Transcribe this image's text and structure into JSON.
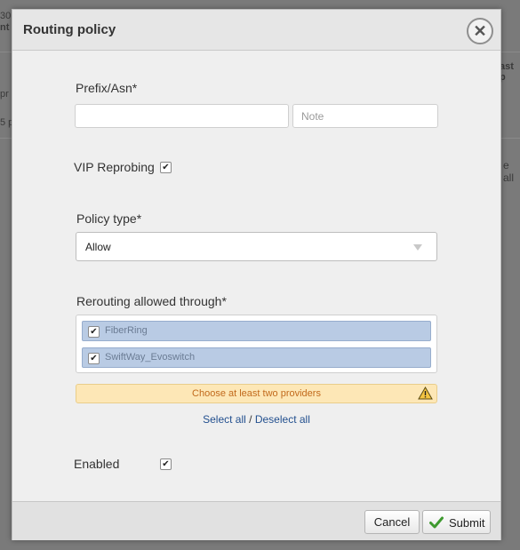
{
  "background": {
    "fragments": [
      "30",
      "nt",
      "pr",
      "5 p",
      "ast p",
      "e all"
    ]
  },
  "dialog": {
    "title": "Routing policy",
    "close_icon": "close-icon",
    "prefix": {
      "label": "Prefix/Asn*",
      "value": "",
      "note_placeholder": "Note"
    },
    "vip_reprobing": {
      "label": "VIP Reprobing",
      "checked": true
    },
    "policy_type": {
      "label": "Policy type*",
      "selected": "Allow"
    },
    "rerouting": {
      "label": "Rerouting allowed through*",
      "providers": [
        {
          "label": "FiberRing",
          "checked": true
        },
        {
          "label": "SwiftWay_Evoswitch",
          "checked": true
        }
      ],
      "warning": "Choose at least two providers",
      "select_all": "Select all",
      "separator": "/",
      "deselect_all": "Deselect all"
    },
    "enabled": {
      "label": "Enabled",
      "checked": true
    },
    "footer": {
      "cancel_label": "Cancel",
      "submit_label": "Submit"
    }
  },
  "colors": {
    "provider_selected_bg": "#b9cbe4",
    "warning_bg": "#fde7b6",
    "warning_text": "#c26a1c",
    "link": "#23508f",
    "submit_check": "#3e9a2f"
  }
}
